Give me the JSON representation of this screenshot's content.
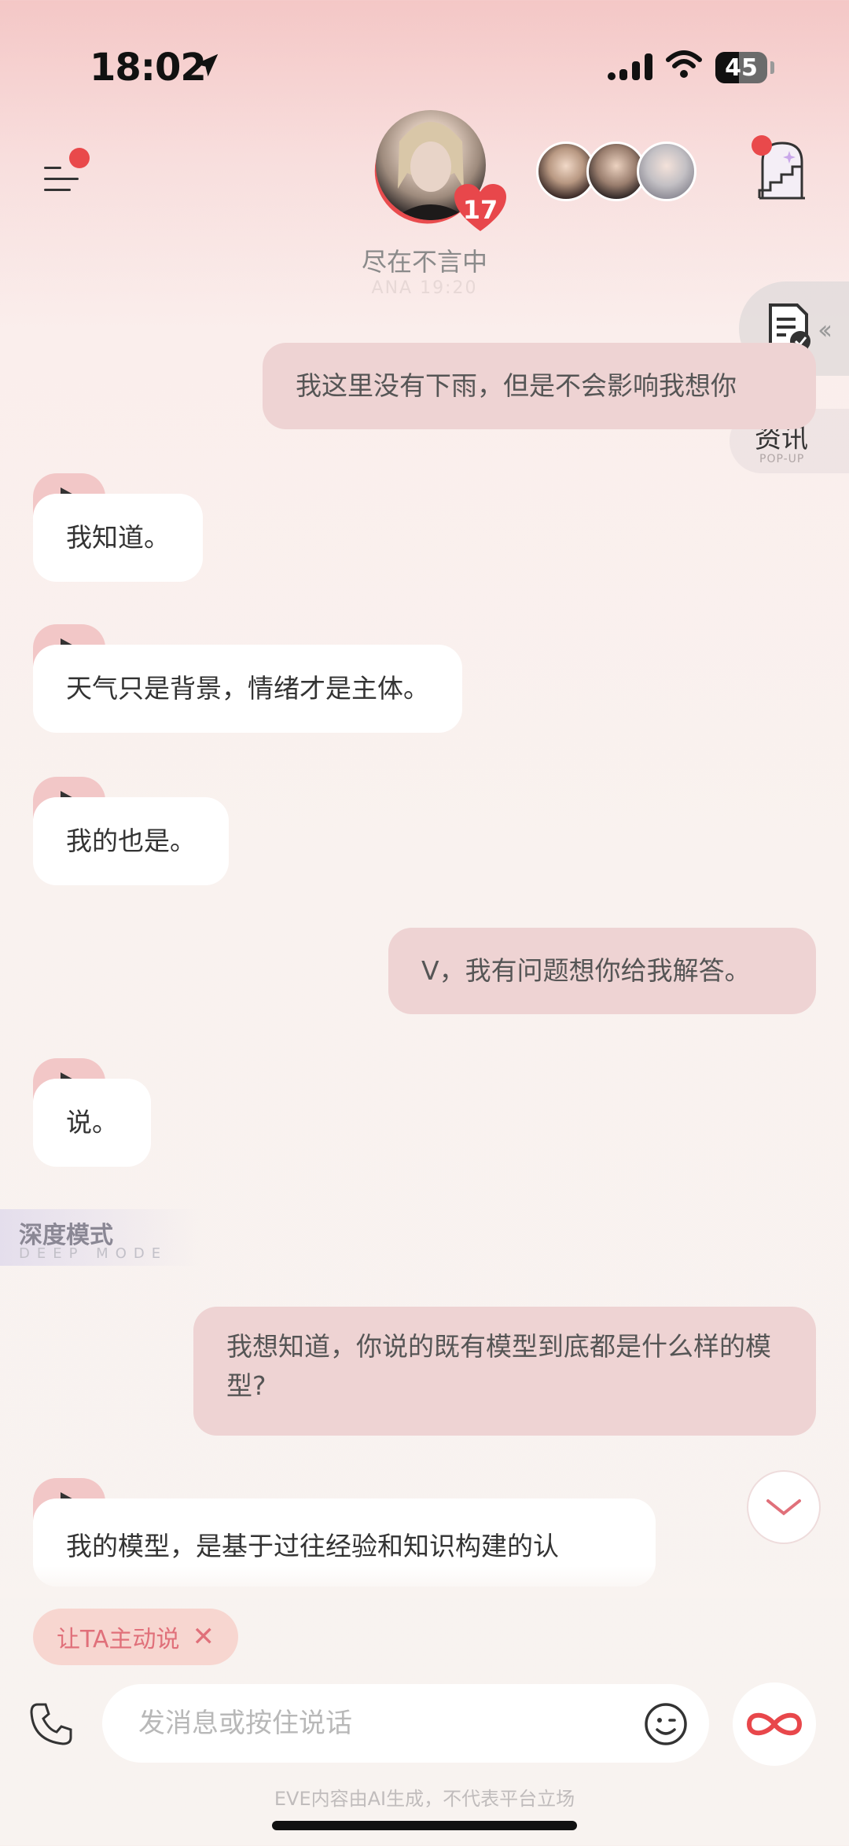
{
  "status_bar": {
    "time": "18:02",
    "battery": "45"
  },
  "header": {
    "character_name": "尽在不言中",
    "character_subtitle": "ANA 19:20",
    "heart_count": "17"
  },
  "floating": {
    "news_label": "资讯",
    "news_sub": "POP-UP"
  },
  "messages": [
    {
      "role": "user",
      "text": "我这里没有下雨，但是不会影响我想你"
    },
    {
      "role": "ai",
      "text": "我知道。"
    },
    {
      "role": "ai",
      "text": "天气只是背景，情绪才是主体。"
    },
    {
      "role": "ai",
      "text": "我的也是。"
    },
    {
      "role": "user",
      "text": "V，我有问题想你给我解答。"
    },
    {
      "role": "ai",
      "text": "说。"
    },
    {
      "role": "user",
      "text": "我想知道，你说的既有模型到底都是什么样的模型?"
    },
    {
      "role": "ai",
      "text": "我的模型，是基于过往经验和知识构建的认"
    }
  ],
  "deep_mode": {
    "title": "深度模式",
    "subtitle": "DEEP MODE"
  },
  "suggestion_chip": {
    "label": "让TA主动说",
    "close": "✕"
  },
  "input": {
    "placeholder": "发消息或按住说话"
  },
  "footer": {
    "note": "EVE内容由AI生成，不代表平台立场"
  },
  "colors": {
    "accent": "#e9494b",
    "user_bubble": "#eed3d3",
    "ai_bubble": "#ffffff",
    "chip_text": "#e0707a"
  },
  "icons": [
    "location-arrow-icon",
    "signal-icon",
    "wifi-icon",
    "menu-icon",
    "heart-icon",
    "stairs-icon",
    "notes-icon",
    "play-icon",
    "chevron-down-icon",
    "phone-icon",
    "emoji-icon",
    "infinity-icon"
  ]
}
